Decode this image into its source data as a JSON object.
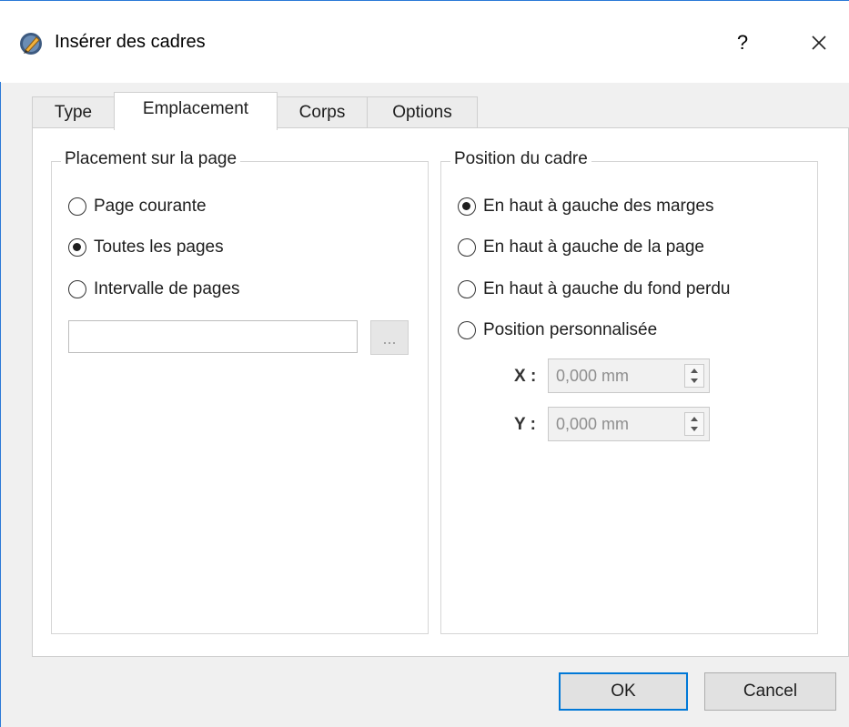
{
  "window": {
    "title": "Insérer des cadres",
    "help_label": "?",
    "close_label": "×"
  },
  "tabs": [
    {
      "label": "Type",
      "active": false
    },
    {
      "label": "Emplacement",
      "active": true
    },
    {
      "label": "Corps",
      "active": false
    },
    {
      "label": "Options",
      "active": false
    }
  ],
  "placement": {
    "title": "Placement sur la page",
    "options": [
      {
        "label": "Page courante",
        "checked": false
      },
      {
        "label": "Toutes les pages",
        "checked": true
      },
      {
        "label": "Intervalle de pages",
        "checked": false
      }
    ],
    "range_value": "",
    "browse_label": "..."
  },
  "position": {
    "title": "Position du cadre",
    "options": [
      {
        "label": "En haut à gauche des marges",
        "checked": true
      },
      {
        "label": "En haut à gauche de la page",
        "checked": false
      },
      {
        "label": "En haut à gauche du fond perdu",
        "checked": false
      },
      {
        "label": "Position personnalisée",
        "checked": false
      }
    ],
    "x_label": "X :",
    "x_value": "0,000 mm",
    "y_label": "Y :",
    "y_value": "0,000 mm"
  },
  "buttons": {
    "ok": "OK",
    "cancel": "Cancel"
  },
  "colors": {
    "accent": "#0078d7",
    "window_border": "#2b79d7"
  },
  "icons": [
    "app-icon",
    "help-icon",
    "close-icon",
    "spin-up-icon",
    "spin-down-icon"
  ]
}
